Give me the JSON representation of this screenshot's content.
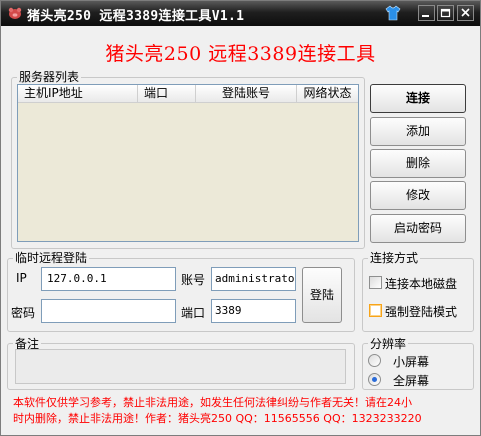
{
  "window": {
    "title": "猪头亮250 远程3389连接工具V1.1"
  },
  "heading": "猪头亮250 远程3389连接工具",
  "server_list": {
    "label": "服务器列表",
    "columns": [
      "主机IP地址",
      "端口",
      "登陆账号",
      "网络状态"
    ],
    "rows": []
  },
  "actions": {
    "connect": "连接",
    "add": "添加",
    "delete": "删除",
    "modify": "修改",
    "boot_password": "启动密码"
  },
  "temp_login": {
    "label": "临时远程登陆",
    "ip_label": "IP",
    "ip_value": "127.0.0.1",
    "account_label": "账号",
    "account_value": "administrator",
    "password_label": "密码",
    "password_value": "",
    "port_label": "端口",
    "port_value": "3389",
    "login_button": "登陆"
  },
  "connect_mode": {
    "label": "连接方式",
    "local_disk": "连接本地磁盘",
    "local_disk_checked": false,
    "force_login": "强制登陆模式",
    "force_login_checked": false
  },
  "notes": {
    "label": "备注",
    "value": ""
  },
  "resolution": {
    "label": "分辨率",
    "small": "小屏幕",
    "full": "全屏幕",
    "selected": "全屏幕"
  },
  "footer": {
    "line1": "本软件仅供学习参考，禁止非法用途，如发生任何法律纠纷与作者无关！请在24小",
    "line2": "时内删除，禁止非法用途！作者：猪头亮250 QQ：11565556 QQ：1323233220"
  },
  "colors": {
    "accent_red": "#ff0000",
    "titlebar": "#1a1a1a",
    "list_bg": "#ece9d8",
    "highlight_orange": "#f8a418"
  }
}
